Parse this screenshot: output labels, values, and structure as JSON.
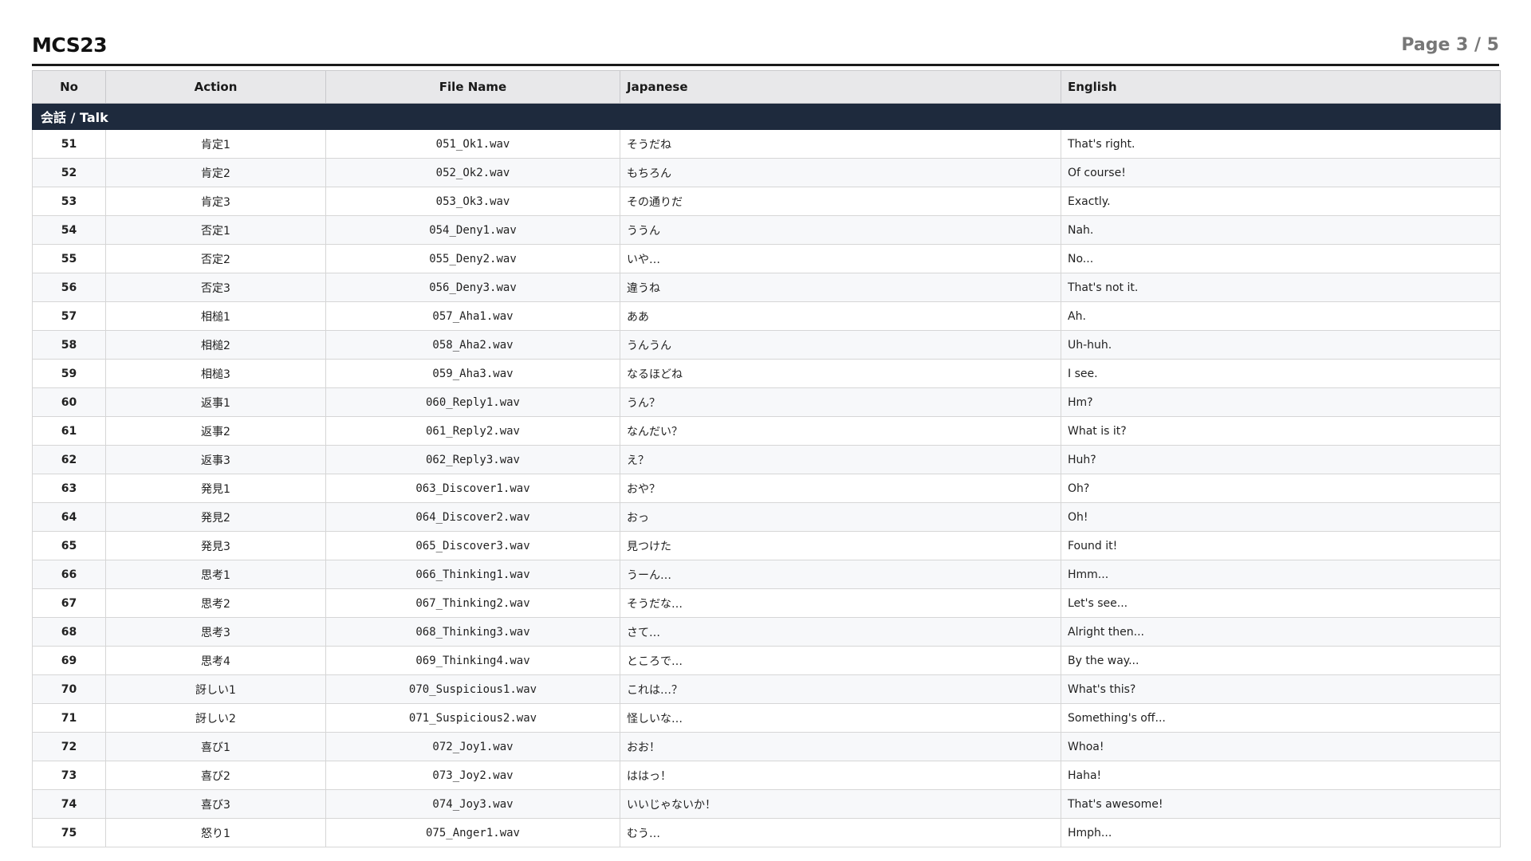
{
  "document": {
    "title": "MCS23",
    "page_indicator": "Page 3 / 5"
  },
  "table": {
    "columns": {
      "no": "No",
      "action": "Action",
      "file_name": "File Name",
      "japanese": "Japanese",
      "english": "English"
    },
    "section": "会話 / Talk",
    "rows": [
      {
        "no": "51",
        "action": "肯定1",
        "file": "051_Ok1.wav",
        "ja": "そうだね",
        "en": "That's right."
      },
      {
        "no": "52",
        "action": "肯定2",
        "file": "052_Ok2.wav",
        "ja": "もちろん",
        "en": "Of course!"
      },
      {
        "no": "53",
        "action": "肯定3",
        "file": "053_Ok3.wav",
        "ja": "その通りだ",
        "en": "Exactly."
      },
      {
        "no": "54",
        "action": "否定1",
        "file": "054_Deny1.wav",
        "ja": "ううん",
        "en": "Nah."
      },
      {
        "no": "55",
        "action": "否定2",
        "file": "055_Deny2.wav",
        "ja": "いや…",
        "en": "No..."
      },
      {
        "no": "56",
        "action": "否定3",
        "file": "056_Deny3.wav",
        "ja": "違うね",
        "en": "That's not it."
      },
      {
        "no": "57",
        "action": "相槌1",
        "file": "057_Aha1.wav",
        "ja": "ああ",
        "en": "Ah."
      },
      {
        "no": "58",
        "action": "相槌2",
        "file": "058_Aha2.wav",
        "ja": "うんうん",
        "en": "Uh-huh."
      },
      {
        "no": "59",
        "action": "相槌3",
        "file": "059_Aha3.wav",
        "ja": "なるほどね",
        "en": "I see."
      },
      {
        "no": "60",
        "action": "返事1",
        "file": "060_Reply1.wav",
        "ja": "うん？",
        "en": "Hm?"
      },
      {
        "no": "61",
        "action": "返事2",
        "file": "061_Reply2.wav",
        "ja": "なんだい？",
        "en": "What is it?"
      },
      {
        "no": "62",
        "action": "返事3",
        "file": "062_Reply3.wav",
        "ja": "え？",
        "en": "Huh?"
      },
      {
        "no": "63",
        "action": "発見1",
        "file": "063_Discover1.wav",
        "ja": "おや？",
        "en": "Oh?"
      },
      {
        "no": "64",
        "action": "発見2",
        "file": "064_Discover2.wav",
        "ja": "おっ",
        "en": "Oh!"
      },
      {
        "no": "65",
        "action": "発見3",
        "file": "065_Discover3.wav",
        "ja": "見つけた",
        "en": "Found it!"
      },
      {
        "no": "66",
        "action": "思考1",
        "file": "066_Thinking1.wav",
        "ja": "うーん…",
        "en": "Hmm..."
      },
      {
        "no": "67",
        "action": "思考2",
        "file": "067_Thinking2.wav",
        "ja": "そうだな…",
        "en": "Let's see..."
      },
      {
        "no": "68",
        "action": "思考3",
        "file": "068_Thinking3.wav",
        "ja": "さて…",
        "en": "Alright then..."
      },
      {
        "no": "69",
        "action": "思考4",
        "file": "069_Thinking4.wav",
        "ja": "ところで…",
        "en": "By the way..."
      },
      {
        "no": "70",
        "action": "訝しい1",
        "file": "070_Suspicious1.wav",
        "ja": "これは…？",
        "en": "What's this?"
      },
      {
        "no": "71",
        "action": "訝しい2",
        "file": "071_Suspicious2.wav",
        "ja": "怪しいな…",
        "en": "Something's off..."
      },
      {
        "no": "72",
        "action": "喜び1",
        "file": "072_Joy1.wav",
        "ja": "おお！",
        "en": "Whoa!"
      },
      {
        "no": "73",
        "action": "喜び2",
        "file": "073_Joy2.wav",
        "ja": "ははっ！",
        "en": "Haha!"
      },
      {
        "no": "74",
        "action": "喜び3",
        "file": "074_Joy3.wav",
        "ja": "いいじゃないか！",
        "en": "That's awesome!"
      },
      {
        "no": "75",
        "action": "怒り1",
        "file": "075_Anger1.wav",
        "ja": "むう…",
        "en": "Hmph..."
      }
    ]
  }
}
